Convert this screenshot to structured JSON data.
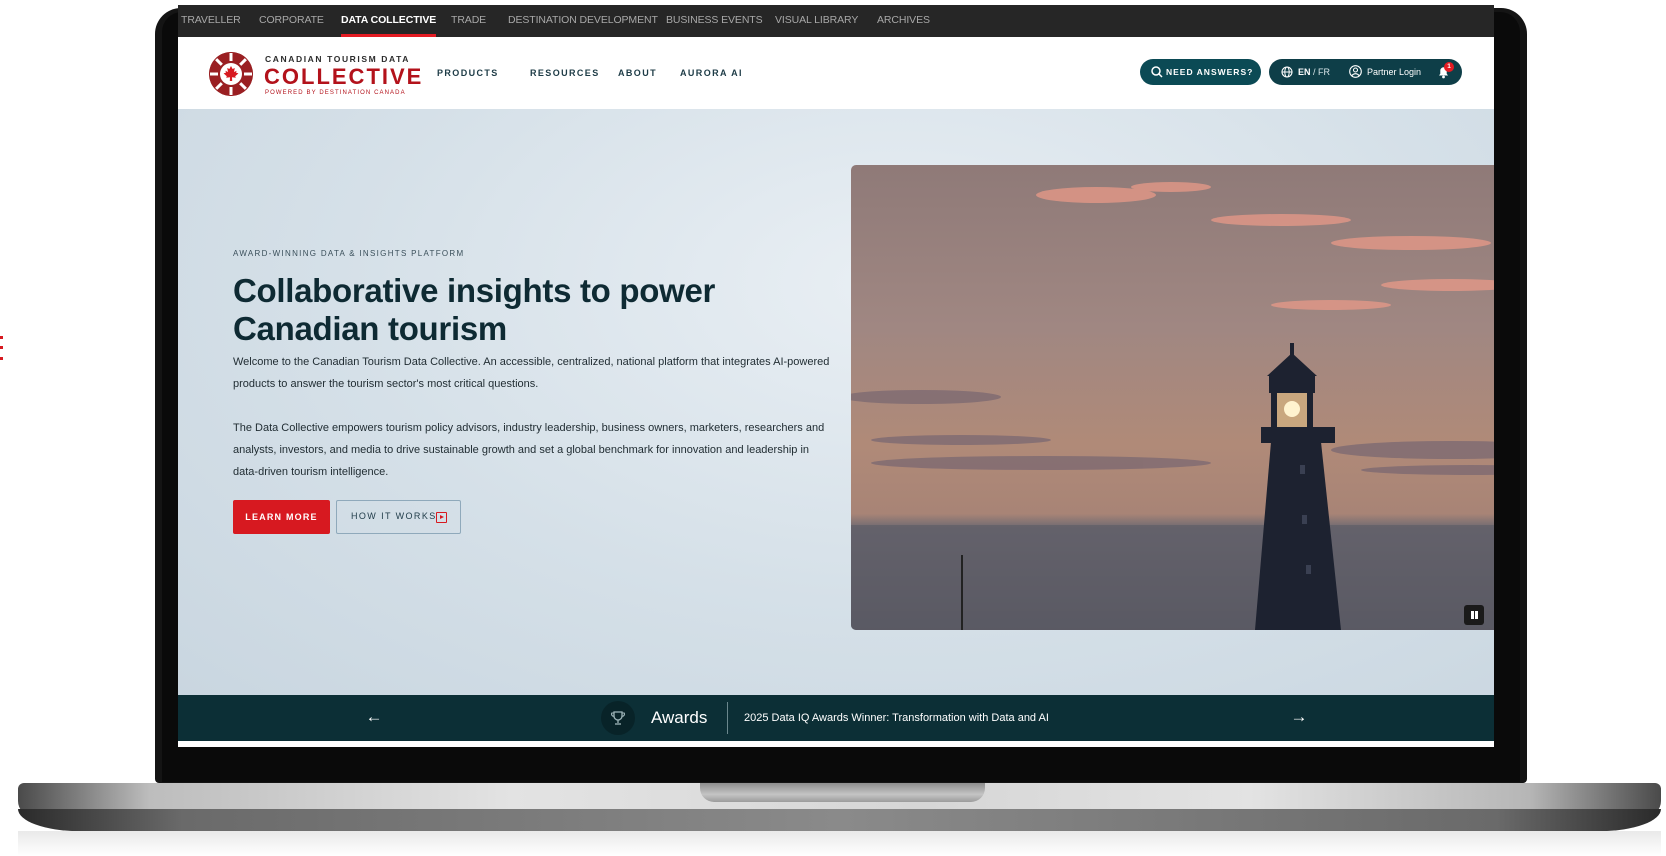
{
  "top_nav": {
    "items": [
      {
        "label": "TRAVELLER",
        "active": false
      },
      {
        "label": "CORPORATE",
        "active": false
      },
      {
        "label": "DATA COLLECTIVE",
        "active": true
      },
      {
        "label": "TRADE",
        "active": false
      },
      {
        "label": "DESTINATION DEVELOPMENT",
        "active": false
      },
      {
        "label": "BUSINESS EVENTS",
        "active": false
      },
      {
        "label": "VISUAL LIBRARY",
        "active": false
      },
      {
        "label": "ARCHIVES",
        "active": false
      }
    ]
  },
  "logo": {
    "line1": "CANADIAN TOURISM DATA",
    "line2": "COLLECTIVE",
    "line3": "POWERED BY DESTINATION CANADA"
  },
  "main_nav": {
    "items": [
      {
        "label": "PRODUCTS"
      },
      {
        "label": "RESOURCES"
      },
      {
        "label": "ABOUT"
      },
      {
        "label": "AURORA AI"
      }
    ]
  },
  "header_actions": {
    "need_answers": "NEED ANSWERS?",
    "lang_en": "EN",
    "lang_sep": " / ",
    "lang_fr": "FR",
    "partner_login": "Partner Login",
    "notification_count": "1"
  },
  "hero": {
    "eyebrow": "AWARD-WINNING DATA & INSIGHTS PLATFORM",
    "headline": "Collaborative insights to power Canadian tourism",
    "paragraph1": "Welcome to the Canadian Tourism Data Collective. An accessible, centralized, national platform that integrates AI-powered products to answer the tourism sector's most critical questions.",
    "paragraph2": "The Data Collective empowers tourism policy advisors, industry leadership, business owners, marketers, researchers and analysts, investors, and media to drive sustainable growth and set a global benchmark for innovation and leadership in data-driven tourism intelligence.",
    "learn_more": "LEARN MORE",
    "how_it_works": "HOW IT WORKS"
  },
  "ticker": {
    "category": "Awards",
    "text": "2025 Data IQ Awards Winner: Transformation with Data and AI",
    "prev_icon": "arrow-left-icon",
    "next_icon": "arrow-right-icon"
  },
  "colors": {
    "brand_red": "#d71920",
    "teal_dark": "#0c2f36",
    "pill_teal": "#0b4a55",
    "top_bar": "#262626"
  }
}
